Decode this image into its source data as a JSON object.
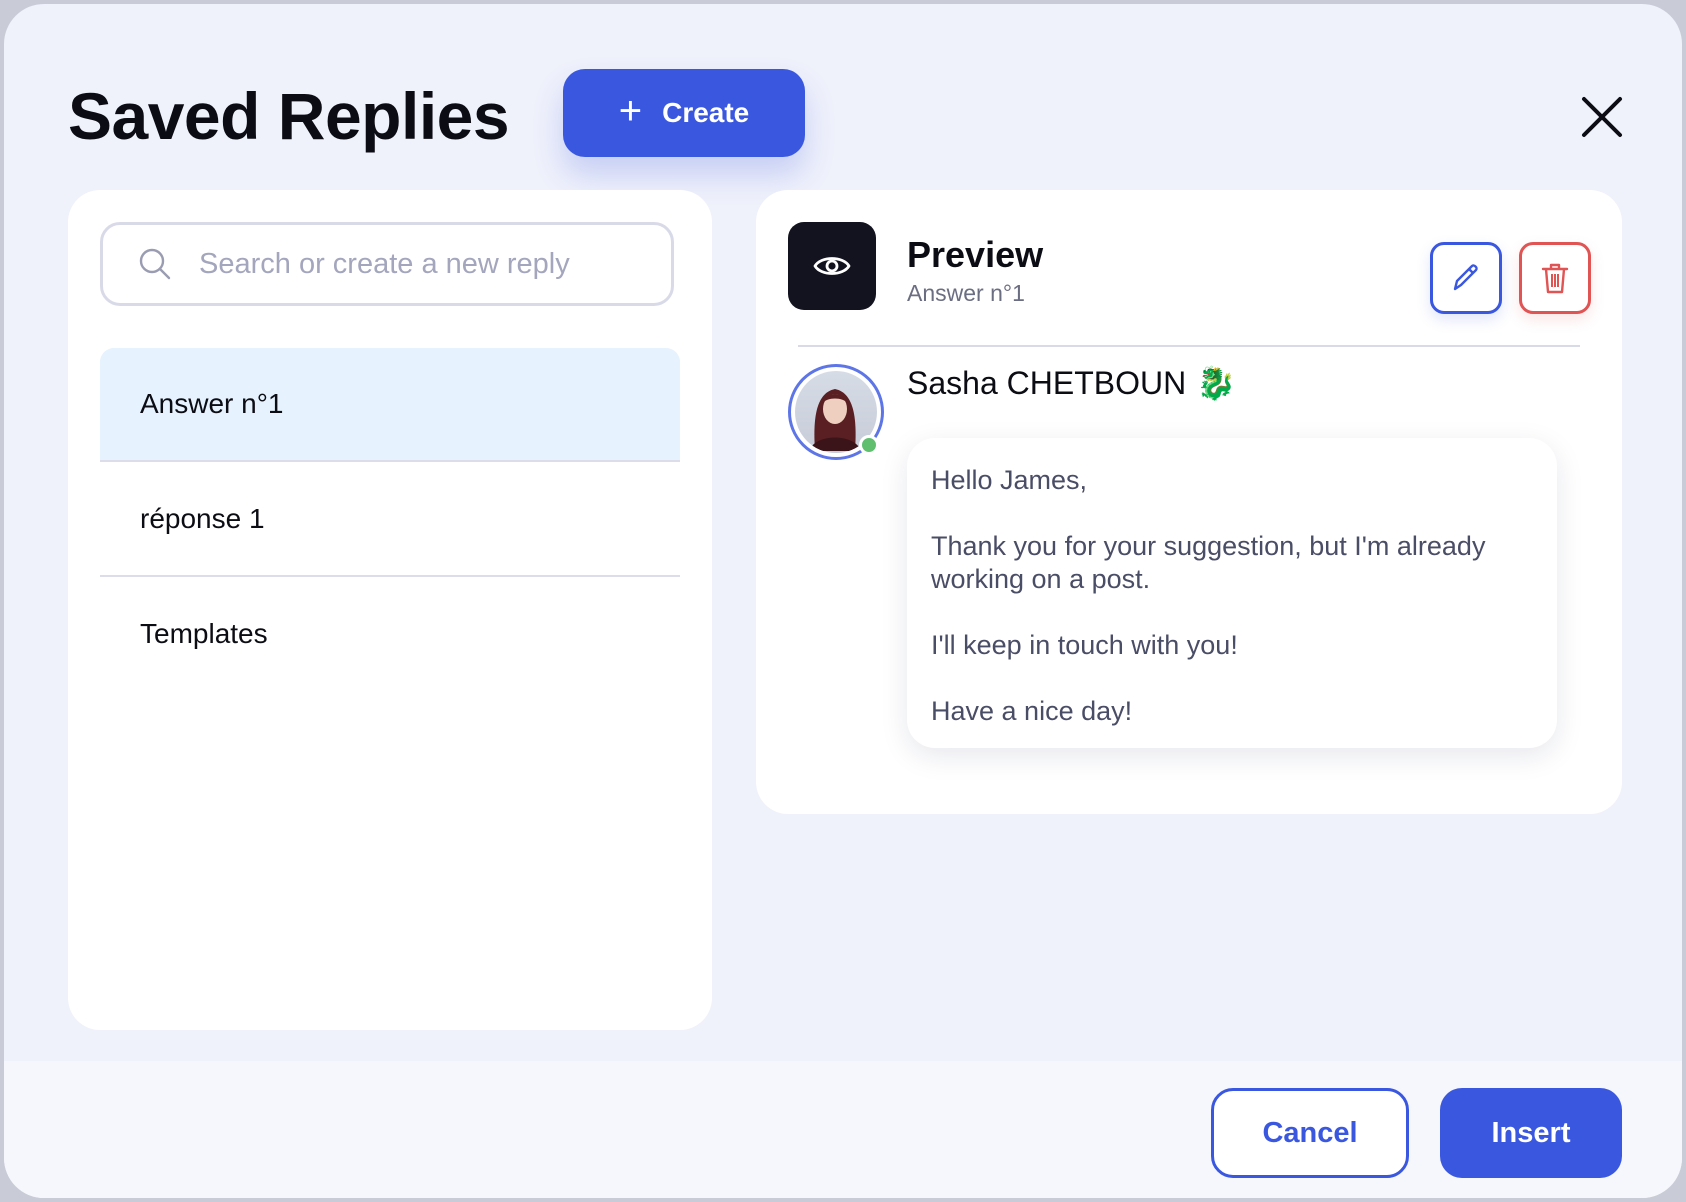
{
  "header": {
    "title": "Saved Replies",
    "create_label": "Create",
    "create_icon": "plus-icon",
    "close_icon": "close-icon"
  },
  "search": {
    "placeholder": "Search or create a new reply",
    "value": "",
    "icon": "search-icon"
  },
  "replies": [
    {
      "label": "Answer n°1",
      "selected": true
    },
    {
      "label": "réponse 1",
      "selected": false
    },
    {
      "label": "Templates",
      "selected": false
    }
  ],
  "preview": {
    "icon": "eye-icon",
    "title": "Preview",
    "subtitle": "Answer n°1",
    "edit_icon": "pencil-icon",
    "delete_icon": "trash-icon",
    "author": "Sasha CHETBOUN",
    "author_badge": "🐉",
    "message": [
      "Hello James,",
      "Thank you for your suggestion, but I'm already working on a post.",
      "I'll keep in touch with you!",
      "Have a nice day!"
    ]
  },
  "footer": {
    "cancel_label": "Cancel",
    "insert_label": "Insert"
  },
  "colors": {
    "accent": "#3a57e0",
    "danger": "#e05454",
    "selected_bg": "#e6f2fd",
    "online": "#5fbf6f",
    "background": "#eff1fb"
  }
}
